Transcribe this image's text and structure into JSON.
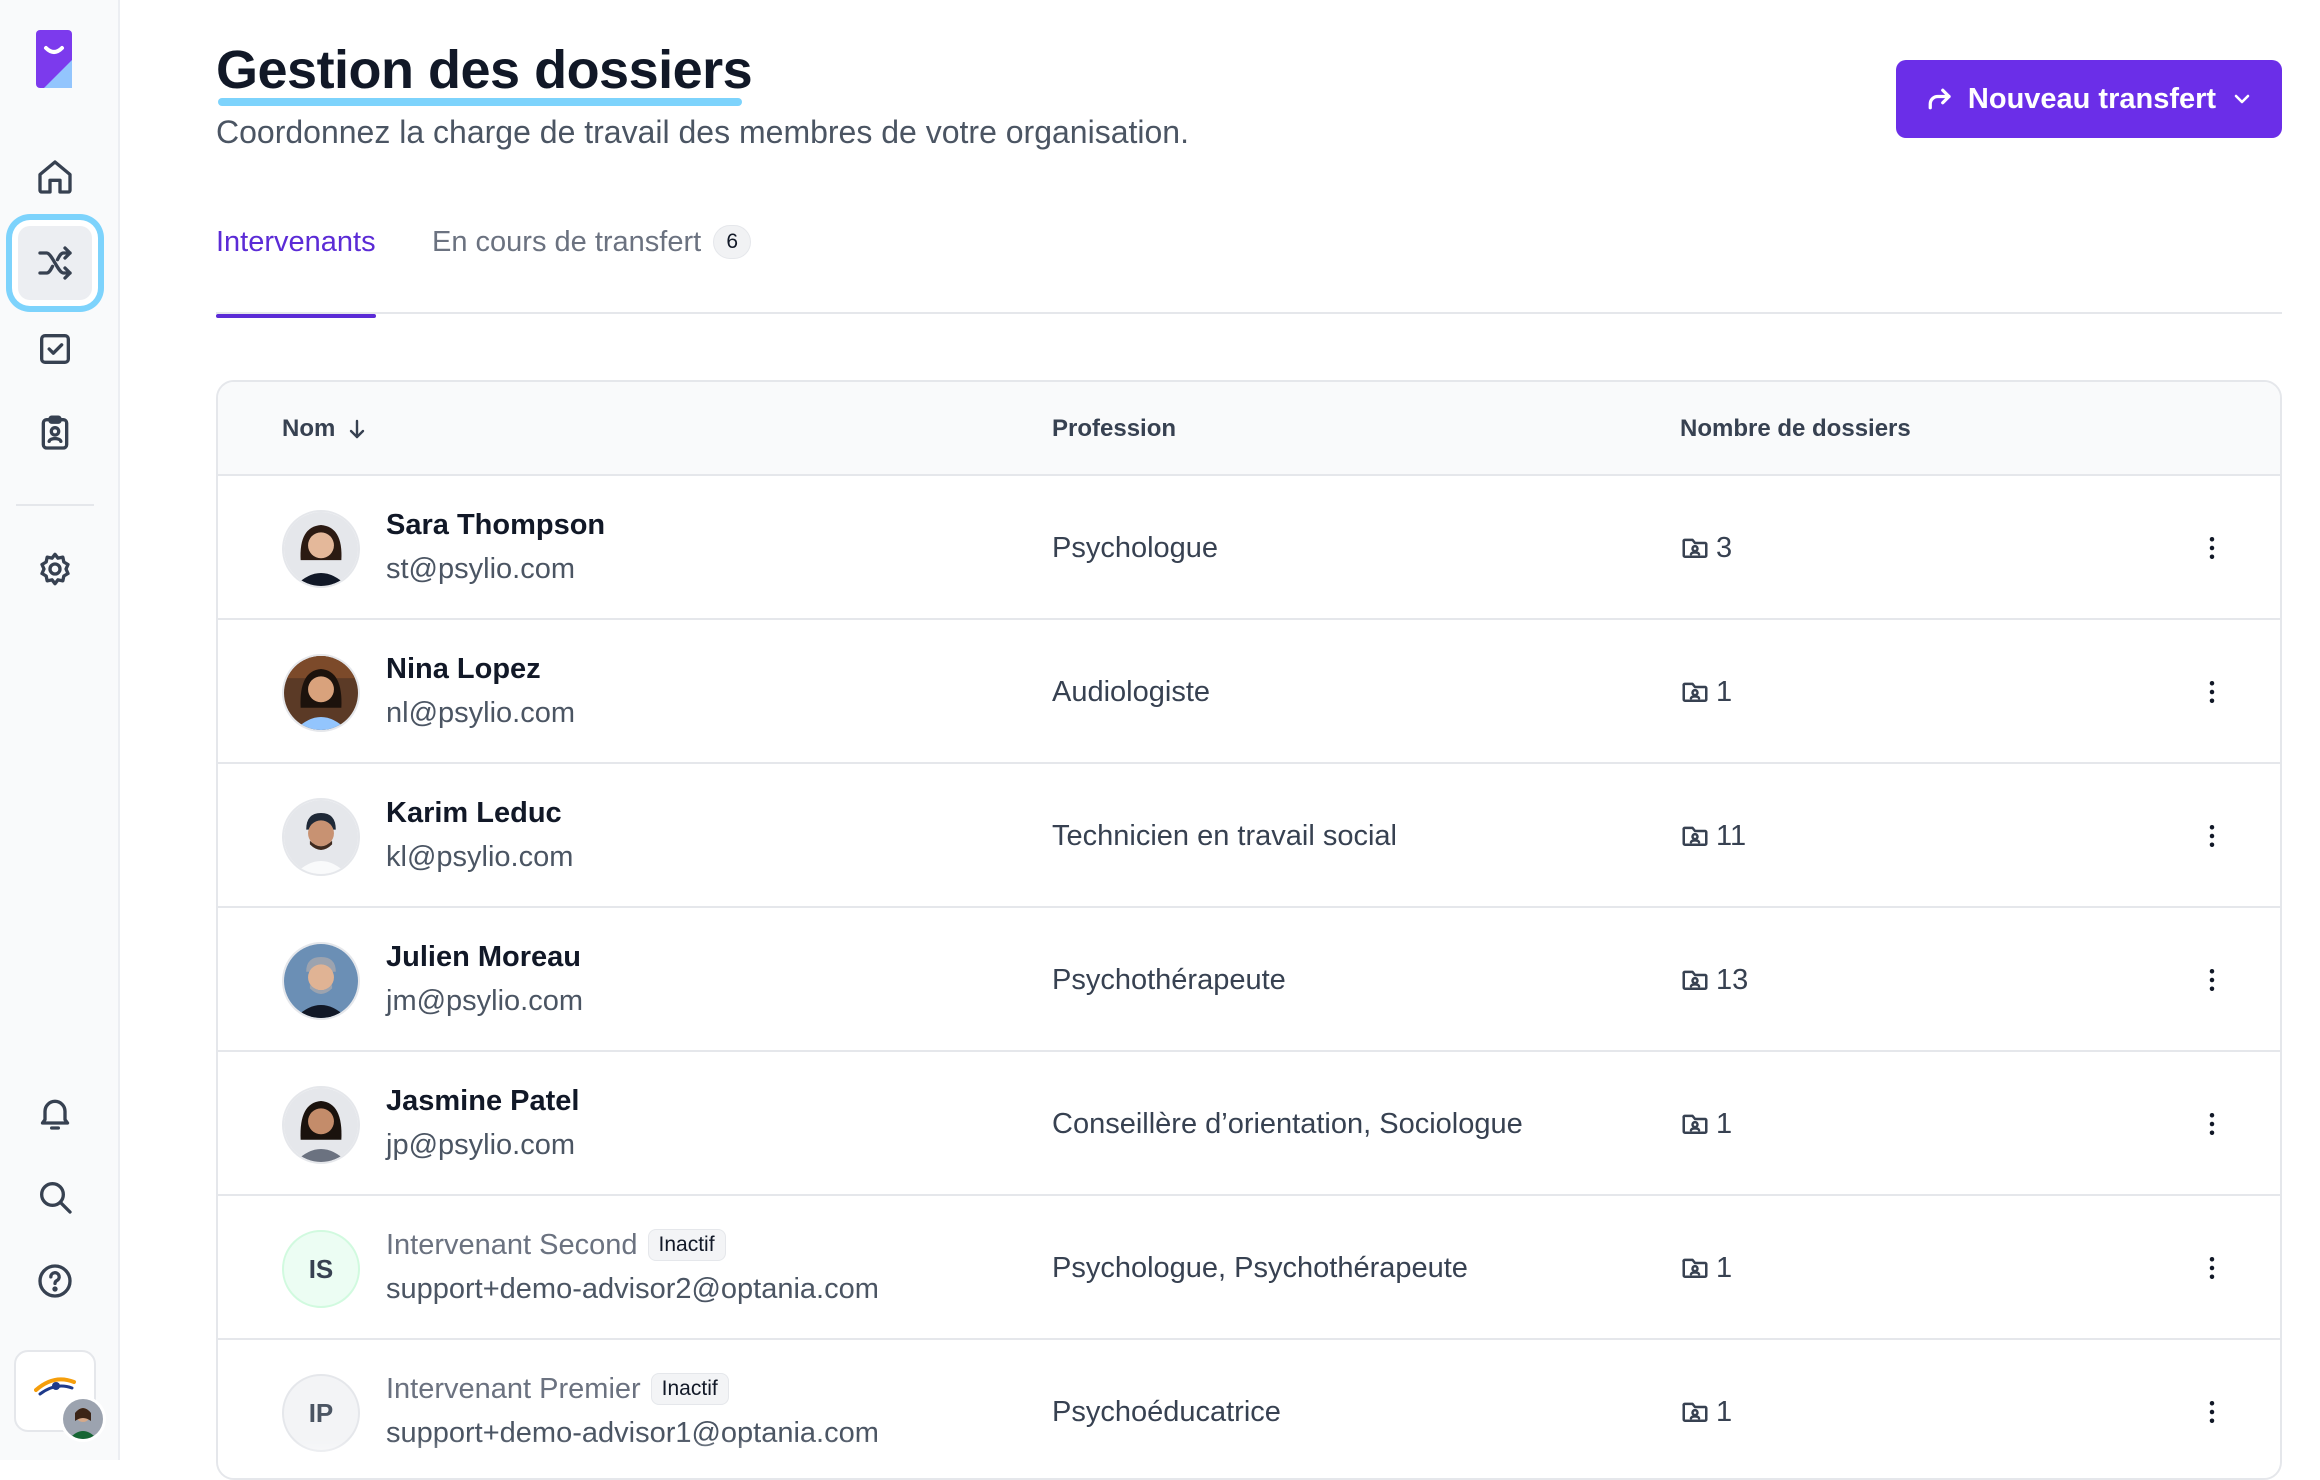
{
  "header": {
    "title": "Gestion des dossiers",
    "subtitle": "Coordonnez la charge de travail des membres de votre organisation.",
    "cta_label": "Nouveau transfert"
  },
  "tabs": [
    {
      "label": "Intervenants",
      "active": true
    },
    {
      "label": "En cours de transfert",
      "count": "6",
      "active": false
    }
  ],
  "table": {
    "columns": {
      "name": "Nom",
      "profession": "Profession",
      "cases": "Nombre de dossiers"
    },
    "rows": [
      {
        "name": "Sara Thompson",
        "email": "st@psylio.com",
        "profession": "Psychologue",
        "cases": "3"
      },
      {
        "name": "Nina Lopez",
        "email": "nl@psylio.com",
        "profession": "Audiologiste",
        "cases": "1"
      },
      {
        "name": "Karim Leduc",
        "email": "kl@psylio.com",
        "profession": "Technicien en travail social",
        "cases": "11"
      },
      {
        "name": "Julien Moreau",
        "email": "jm@psylio.com",
        "profession": "Psychothérapeute",
        "cases": "13"
      },
      {
        "name": "Jasmine Patel",
        "email": "jp@psylio.com",
        "profession": "Conseillère d’orientation, Sociologue",
        "cases": "1"
      },
      {
        "name": "Intervenant Second",
        "initials": "IS",
        "status": "Inactif",
        "email": "support+demo-advisor2@optania.com",
        "profession": "Psychologue, Psychothérapeute",
        "cases": "1"
      },
      {
        "name": "Intervenant Premier",
        "initials": "IP",
        "status": "Inactif",
        "email": "support+demo-advisor1@optania.com",
        "profession": "Psychoéducatrice",
        "cases": "1"
      }
    ]
  },
  "icons": {
    "sidebar": [
      "home-icon",
      "shuffle-icon",
      "checkbox-icon",
      "clipboard-user-icon",
      "gear-icon",
      "bell-icon",
      "search-icon",
      "help-icon"
    ],
    "row_actions": "more-vertical-icon",
    "cases": "folder-user-icon"
  },
  "colors": {
    "accent": "#5b2bd6",
    "cta": "#6b2ee8",
    "highlight": "#7dd3fc"
  }
}
